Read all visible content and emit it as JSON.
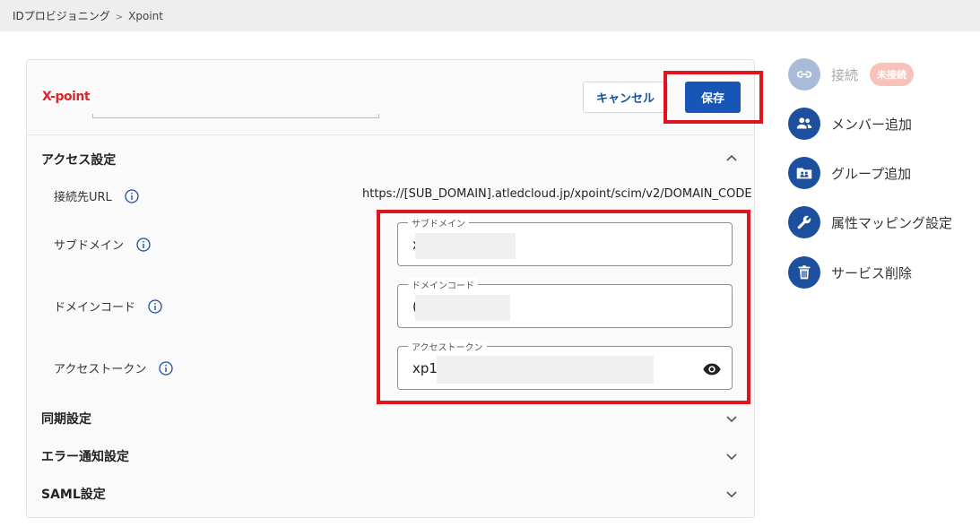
{
  "breadcrumb": {
    "root": "IDプロビジョニング",
    "separator": ">",
    "current": "Xpoint"
  },
  "header": {
    "logo_text": "X-point",
    "cancel_label": "キャンセル",
    "save_label": "保存"
  },
  "sections": {
    "access": {
      "title": "アクセス設定"
    },
    "sync": {
      "title": "同期設定"
    },
    "error_notify": {
      "title": "エラー通知設定"
    },
    "saml": {
      "title": "SAML設定"
    }
  },
  "access_rows": {
    "url_label": "接続先URL",
    "url_value": "https://[SUB_DOMAIN].atledcloud.jp/xpoint/scim/v2/DOMAIN_CODE",
    "subdomain_label": "サブドメイン",
    "domain_code_label": "ドメインコード",
    "token_label": "アクセストークン"
  },
  "fields": {
    "subdomain": {
      "label": "サブドメイン",
      "value": "x"
    },
    "domain_code": {
      "label": "ドメインコード",
      "value": "("
    },
    "token": {
      "label": "アクセストークン",
      "value": "xp1."
    }
  },
  "sidebar": {
    "connect": {
      "label": "接続",
      "badge": "未接続",
      "icon": "link-icon"
    },
    "add_member": {
      "label": "メンバー追加",
      "icon": "people-icon"
    },
    "add_group": {
      "label": "グループ追加",
      "icon": "group-folder-icon"
    },
    "attr_mapping": {
      "label": "属性マッピング設定",
      "icon": "wrench-icon"
    },
    "delete_service": {
      "label": "サービス削除",
      "icon": "trash-icon"
    }
  },
  "colors": {
    "primary": "#1756b6",
    "highlight": "#e0141e",
    "logo": "#e0262c",
    "badge": "#f7c2bb"
  }
}
